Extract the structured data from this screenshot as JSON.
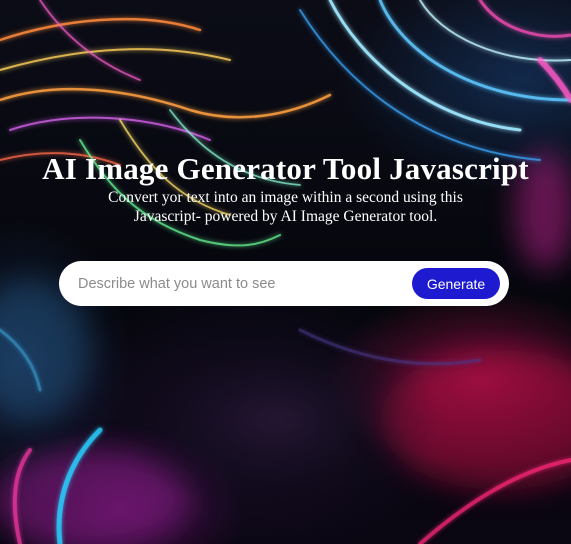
{
  "hero": {
    "title": "AI Image Generator Tool Javascript",
    "subtitle": "Convert yor text into an image within a second using this Javascript- powered by AI Image Generator tool."
  },
  "form": {
    "placeholder": "Describe what you want to see",
    "value": "",
    "button_label": "Generate"
  },
  "colors": {
    "button": "#1d1ad0",
    "text": "#ffffff",
    "input_background": "#ffffff"
  }
}
